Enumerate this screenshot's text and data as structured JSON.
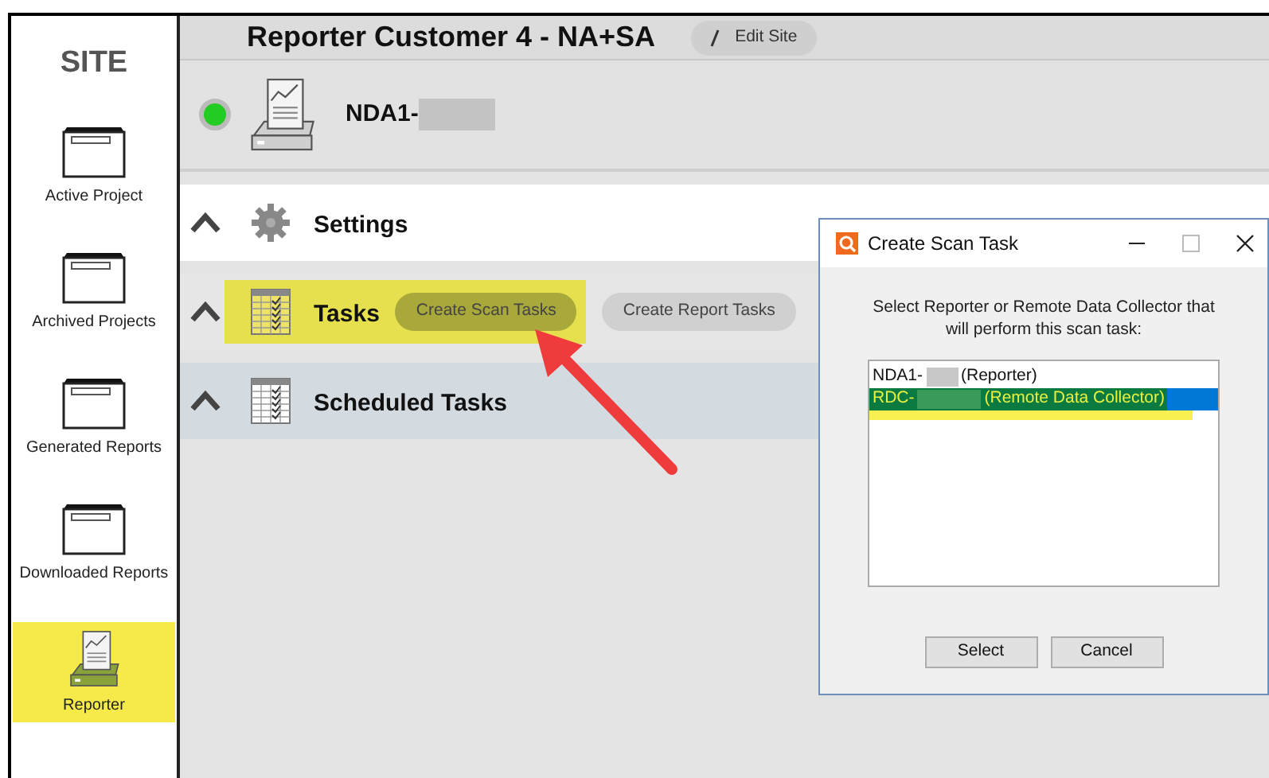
{
  "sidebar": {
    "heading": "SITE",
    "items": [
      {
        "label": "Active Project",
        "kind": "folder",
        "selected": false
      },
      {
        "label": "Archived Projects",
        "kind": "folder",
        "selected": false
      },
      {
        "label": "Generated Reports",
        "kind": "folder",
        "selected": false
      },
      {
        "label": "Downloaded Reports",
        "kind": "folder",
        "selected": false
      },
      {
        "label": "Reporter",
        "kind": "reporter",
        "selected": true
      }
    ]
  },
  "header": {
    "title": "Reporter Customer 4 - NA+SA",
    "edit_button": "Edit Site"
  },
  "device": {
    "name": "NDA1-",
    "online": true
  },
  "sections": [
    {
      "title": "Settings",
      "kind": "settings",
      "expanded": true,
      "highlighted": false
    },
    {
      "title": "Tasks",
      "kind": "tasks",
      "expanded": true,
      "highlighted": true,
      "buttons": [
        {
          "label": "Create Scan Tasks",
          "highlighted": true
        },
        {
          "label": "Create Report Tasks",
          "highlighted": false
        }
      ]
    },
    {
      "title": "Scheduled Tasks",
      "kind": "scheduled",
      "expanded": true,
      "highlighted": false
    }
  ],
  "dialog": {
    "title": "Create Scan Task",
    "prompt": "Select Reporter or Remote Data Collector that will perform this scan task:",
    "items": [
      {
        "label": "NDA1-",
        "suffix": "(Reporter)",
        "selected": false
      },
      {
        "label": "RDC-",
        "suffix": "(Remote Data Collector)",
        "selected": true
      }
    ],
    "buttons": [
      "Select",
      "Cancel"
    ]
  }
}
